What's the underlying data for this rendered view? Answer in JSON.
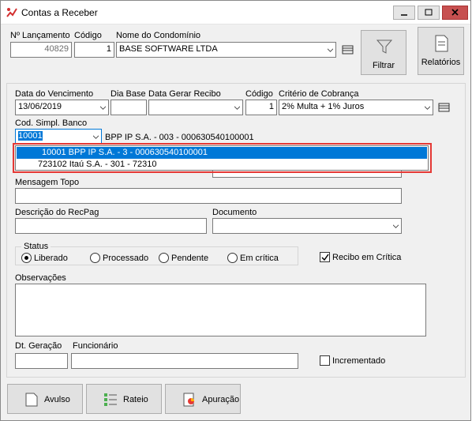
{
  "window": {
    "title": "Contas a Receber"
  },
  "top": {
    "lancamento_label": "Nº Lançamento",
    "lancamento_value": "40829",
    "codigo_label": "Código",
    "codigo_value": "1",
    "condominio_label": "Nome do Condomínio",
    "condominio_value": "BASE SOFTWARE LTDA",
    "filtrar_label": "Filtrar",
    "relatorios_label": "Relatórios"
  },
  "form": {
    "vencimento_label": "Data do Vencimento",
    "vencimento_value": "13/06/2019",
    "dia_base_label": "Dia Base",
    "dia_base_value": "",
    "gerar_recibo_label": "Data Gerar Recibo",
    "gerar_recibo_value": "",
    "codigo2_label": "Código",
    "codigo2_value": "1",
    "criterio_label": "Critério de Cobrança",
    "criterio_value": "2% Multa + 1% Juros",
    "banco_label": "Cod. Simpl. Banco",
    "banco_value": "10001",
    "banco_desc": "BPP IP S.A. - 003 - 000630540100001",
    "banco_options": [
      "10001 BPP IP S.A. - 3 - 000630540100001",
      "723102 Itaú S.A. - 301 - 72310"
    ],
    "mensagem_label": "Mensagem Topo",
    "mensagem_value": "",
    "descricao_label": "Descrição do RecPag",
    "descricao_value": "",
    "documento_label": "Documento",
    "documento_value": "",
    "status_label": "Status",
    "status_options": [
      "Liberado",
      "Processado",
      "Pendente",
      "Em crítica"
    ],
    "status_selected": "Liberado",
    "recibo_critica_label": "Recibo em Crítica",
    "recibo_critica_checked": true,
    "observacoes_label": "Observações",
    "observacoes_value": "",
    "dt_geracao_label": "Dt. Geração",
    "dt_geracao_value": "",
    "funcionario_label": "Funcionário",
    "funcionario_value": "",
    "incrementado_label": "Incrementado",
    "incrementado_checked": false
  },
  "bottom": {
    "avulso_label": "Avulso",
    "rateio_label": "Rateio",
    "apuracao_label": "Apuração"
  }
}
